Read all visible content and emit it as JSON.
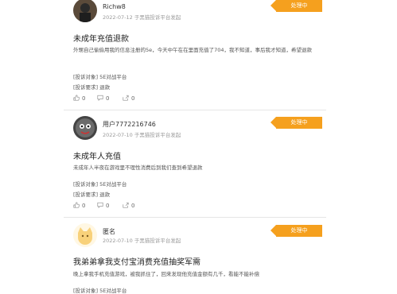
{
  "posts": [
    {
      "username": "Richw8",
      "meta": "2022-07-12 于黑猫投诉平台发起",
      "status": "处理中",
      "title": "未成年充值退款",
      "body": "外甥自己偷偷用我的信息注册的5e，今天中午在在里面充值了704，我不知道，事后我才知道，希望退款",
      "object_label": "[投诉对象]",
      "object_value": "5E对战平台",
      "request_label": "[投诉要求]",
      "request_value": "退款",
      "likes": "0",
      "comments": "0",
      "shares": "0"
    },
    {
      "username": "用户7772216746",
      "meta": "2022-07-10 于黑猫投诉平台发起",
      "status": "处理中",
      "title": "未成年人充值",
      "body": "未成年人半夜在游戏里不理性消费后到我们查到希望退款",
      "object_label": "[投诉对象]",
      "object_value": "5E对战平台",
      "request_label": "[投诉要求]",
      "request_value": "退款",
      "likes": "0",
      "comments": "0",
      "shares": "0"
    },
    {
      "username": "匿名",
      "meta": "2022-07-10 于黑猫投诉平台发起",
      "status": "处理中",
      "title": "我弟弟拿我支付宝消费充值抽奖军需",
      "body": "晚上拿我手机充值游戏，被我抓住了，回来发现他充值金额有几千，看能不能补偿",
      "object_label": "[投诉对象]",
      "object_value": "5E对战平台"
    }
  ],
  "colors": {
    "badge": "#f5a01e",
    "divider": "#e6e6e6"
  },
  "icons": [
    "like-icon",
    "comment-icon",
    "share-icon"
  ]
}
